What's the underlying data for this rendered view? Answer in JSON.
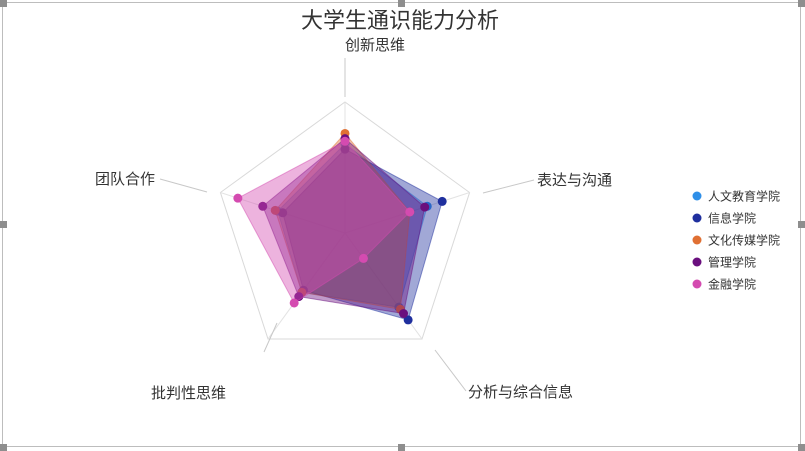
{
  "chart_data": {
    "type": "radar",
    "title": "大学生通识能力分析",
    "axes": [
      "创新思维",
      "表达与沟通",
      "分析与综合信息",
      "批判性思维",
      "团队合作"
    ],
    "range": [
      0,
      5
    ],
    "grid": true,
    "legend_position": "right",
    "series": [
      {
        "name": "人文教育学院",
        "color": "#2f8fe8",
        "values": [
          3.4,
          3.3,
          3.5,
          2.8,
          2.7
        ]
      },
      {
        "name": "信息学院",
        "color": "#1f2f9e",
        "values": [
          3.2,
          3.9,
          4.1,
          2.7,
          2.5
        ]
      },
      {
        "name": "文化传媒学院",
        "color": "#e07033",
        "values": [
          3.8,
          2.6,
          3.6,
          2.8,
          2.8
        ]
      },
      {
        "name": "管理学院",
        "color": "#6a0f7e",
        "values": [
          3.6,
          3.2,
          3.8,
          3.0,
          3.3
        ]
      },
      {
        "name": "金融学院",
        "color": "#d44bb0",
        "values": [
          3.5,
          2.6,
          1.2,
          3.3,
          4.3
        ]
      }
    ]
  }
}
